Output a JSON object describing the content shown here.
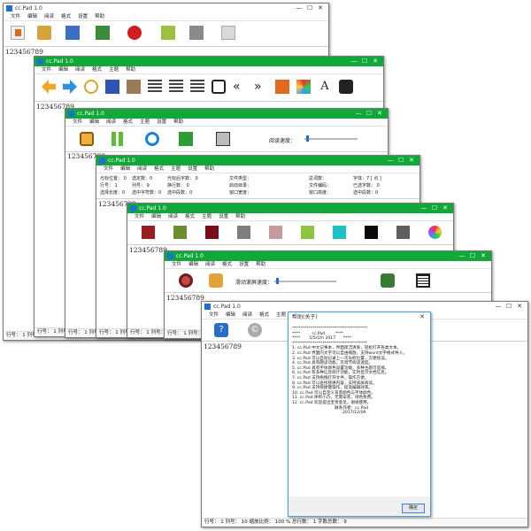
{
  "app_title": "cc.Pad 1.0",
  "controls": {
    "min": "—",
    "max": "☐",
    "close": "✕"
  },
  "w1": {
    "menu": [
      "文件",
      "编辑",
      "阅读",
      "格式",
      "设置",
      "帮助"
    ],
    "content": "123456789",
    "status": "行号： 1 列号："
  },
  "w2": {
    "menu": [
      "文件",
      "编辑",
      "阅读",
      "格式",
      "主题",
      "帮助"
    ],
    "content": "123456789",
    "status": "行号： 1 列号："
  },
  "w3": {
    "menu": [
      "文件",
      "编辑",
      "阅读",
      "格式",
      "主题",
      "设置",
      "帮助"
    ],
    "speed_label": "阅读速度：",
    "content": "123456789",
    "status": "行号： 1 列号："
  },
  "w4": {
    "menu": [
      "文件",
      "编辑",
      "阅读",
      "格式",
      "主题",
      "设置",
      "帮助"
    ],
    "rows": [
      [
        "光标位置： 0",
        "选定数：0",
        "光标后字数： 0",
        "文件类型：",
        "总词数：",
        "字体：7  [ 点 ]"
      ],
      [
        "行号： 1",
        "列号： 9",
        "换行数： 0",
        "启动目录：",
        "文件编码：",
        "已选字数： 0"
      ],
      [
        "选择长度：0",
        "选中字符数：0",
        "选中段数：0",
        "窗口宽度：",
        "窗口高度：",
        "选中段数：0"
      ]
    ],
    "content": "123456789",
    "status": "行号： 1 列号："
  },
  "w5": {
    "menu": [
      "文件",
      "编辑",
      "阅读",
      "格式",
      "主题",
      "设置",
      "帮助"
    ],
    "colors": [
      "#9b1d20",
      "#6c8e2f",
      "#7b0d16",
      "#7e7e7e",
      "#c49a9a",
      "#8cc63e",
      "#1ec0c8",
      "#0a0a0a",
      "#5f5f5f"
    ],
    "content": "123456789",
    "status": "行号： 1 列号："
  },
  "w6": {
    "menu": [
      "文件",
      "编辑",
      "阅读",
      "格式",
      "设置",
      "帮助"
    ],
    "scroll_label": "滑动滚屏速度：",
    "content": "123456789",
    "status": "行号： 1 列号："
  },
  "w7": {
    "menu": [
      "文件",
      "编辑",
      "阅读",
      "格式",
      "主题",
      "设置",
      "帮助"
    ],
    "content": "123456789",
    "status": "行号： 1 列号： 10 缩放比例： 100 % 总行数： 1 字数总数： 9"
  },
  "about": {
    "title": "帮助(关于)",
    "lines": [
      "*************************************",
      "****         cc.Pad        ****",
      "****       5/5/1th 2017      ****",
      "*************************************",
      "",
      "1. cc.Pad 中文记事本，界面简洁清爽，轻松打开各类文本。",
      "2. cc.Pad 界面内文字可以自由缩放，支持word文字格式导入。",
      "3. cc.Pad 可以自动记录上一次光标位置，方便续读。",
      "4. cc.Pad 具有朗读功能，可调节阅读速度。",
      "5. cc.Pad 具有字体颜色设置功能，多种主题可选择。",
      "6. cc.Pad 有多种信息统计功能，实时显示文档信息。",
      "7. cc.Pad 支持拖拽打开文件，操作方便。",
      "8. cc.Pad 可以查找替换内容，支持滚屏阅读。",
      "9. cc.Pad 支持快捷键操作，提高编辑效率。",
      "10. cc.Pad 可以自定义背景颜色与字体颜色。",
      "11. cc.Pad 体积小巧，无需安装，绿色免费。",
      "12. cc.Pad 欢迎提出宝贵意见，谢谢使用。",
      "",
      "                                 联系作者：cc.Pad",
      "                                       2017/12/09"
    ],
    "ok": "确定"
  }
}
